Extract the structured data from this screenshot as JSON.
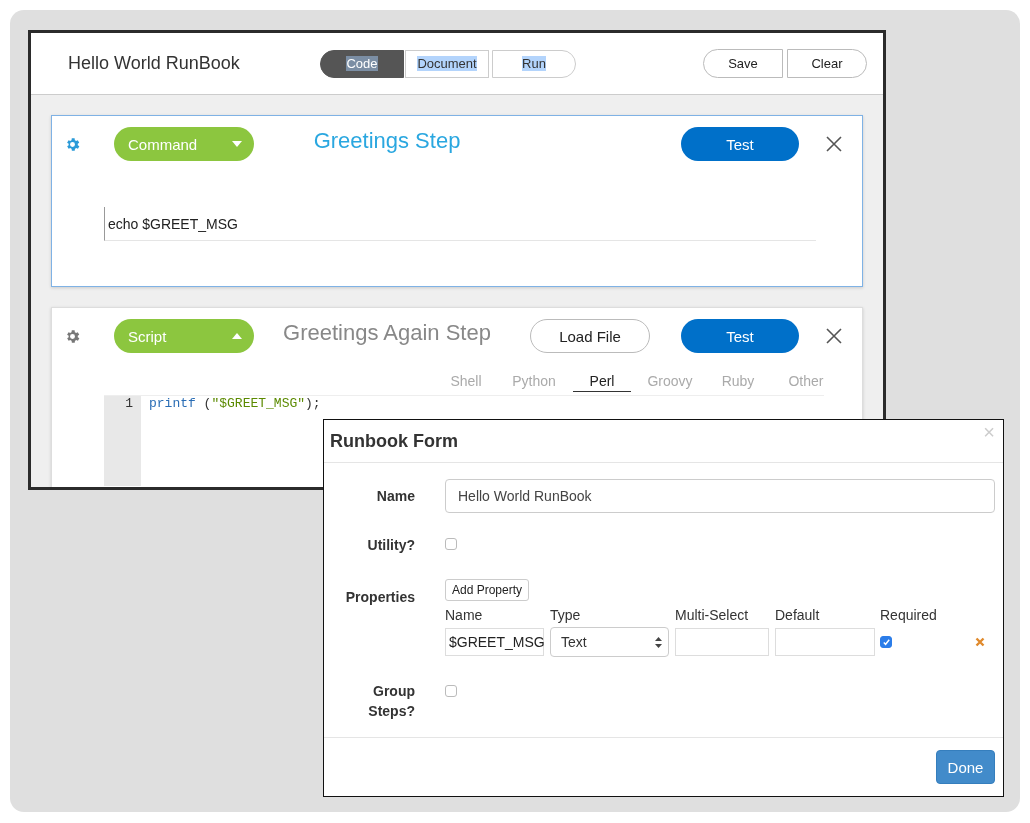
{
  "header": {
    "title": "Hello World RunBook",
    "tabs": [
      {
        "label": "Code",
        "selected": true
      },
      {
        "label": "Document",
        "selected": false
      },
      {
        "label": "Run",
        "selected": false
      }
    ],
    "buttons": [
      "Save",
      "Clear"
    ]
  },
  "steps": [
    {
      "kind": "command",
      "type": "Command",
      "expanded": false,
      "title": "Greetings Step",
      "selected": true,
      "test_button": "Test",
      "command": "echo $GREET_MSG"
    },
    {
      "kind": "script",
      "type": "Script",
      "expanded": true,
      "title": "Greetings Again Step",
      "selected": false,
      "load_button": "Load File",
      "test_button": "Test",
      "languages": [
        {
          "label": "Shell",
          "selected": false
        },
        {
          "label": "Python",
          "selected": false
        },
        {
          "label": "Perl",
          "selected": true
        },
        {
          "label": "Groovy",
          "selected": false
        },
        {
          "label": "Ruby",
          "selected": false
        },
        {
          "label": "Other",
          "selected": false
        }
      ],
      "code_lines": [
        {
          "number": "1",
          "tokens": [
            {
              "kind": "keyword",
              "text": "printf"
            },
            {
              "kind": "plain",
              "text": " ("
            },
            {
              "kind": "string",
              "text": "\"$GREET_MSG\""
            },
            {
              "kind": "plain",
              "text": ");"
            }
          ]
        }
      ]
    }
  ],
  "modal": {
    "title": "Runbook Form",
    "close": "×",
    "name_label": "Name",
    "name_value": "Hello World RunBook",
    "utility_label": "Utility?",
    "utility_checked": false,
    "properties_label": "Properties",
    "add_button": "Add Property",
    "columns": [
      "Name",
      "Type",
      "Multi-Select",
      "Default",
      "Required"
    ],
    "rows": [
      {
        "name": "$GREET_MSG",
        "type": "Text",
        "required": true
      }
    ],
    "group_label": "Group Steps?",
    "group_checked": false,
    "done_button": "Done"
  }
}
